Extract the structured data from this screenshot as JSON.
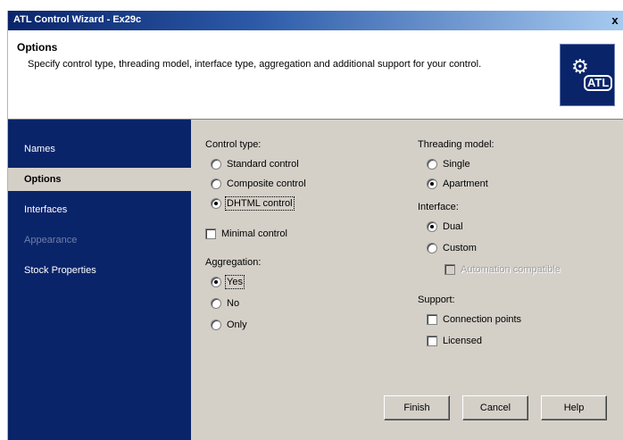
{
  "window": {
    "title": "ATL Control Wizard - Ex29c",
    "close_glyph": "x"
  },
  "header": {
    "title": "Options",
    "description": "Specify control type, threading model, interface type, aggregation and additional support for your control.",
    "logo_text": "ATL",
    "logo_icon": "gear-icon"
  },
  "sidebar": {
    "items": [
      {
        "label": "Names",
        "state": "normal"
      },
      {
        "label": "Options",
        "state": "selected"
      },
      {
        "label": "Interfaces",
        "state": "normal"
      },
      {
        "label": "Appearance",
        "state": "disabled"
      },
      {
        "label": "Stock Properties",
        "state": "normal"
      }
    ]
  },
  "control_type": {
    "label": "Control type:",
    "options": [
      {
        "label": "Standard control",
        "checked": false
      },
      {
        "label": "Composite control",
        "checked": false
      },
      {
        "label": "DHTML control",
        "checked": true
      }
    ]
  },
  "minimal_control": {
    "label": "Minimal control",
    "checked": false
  },
  "aggregation": {
    "label": "Aggregation:",
    "options": [
      {
        "label": "Yes",
        "checked": true
      },
      {
        "label": "No",
        "checked": false
      },
      {
        "label": "Only",
        "checked": false
      }
    ]
  },
  "threading": {
    "label": "Threading model:",
    "options": [
      {
        "label": "Single",
        "checked": false
      },
      {
        "label": "Apartment",
        "checked": true
      }
    ]
  },
  "interface": {
    "label": "Interface:",
    "options": [
      {
        "label": "Dual",
        "checked": true
      },
      {
        "label": "Custom",
        "checked": false
      }
    ],
    "automation_compatible": {
      "label": "Automation compatible",
      "checked": false,
      "enabled": false
    }
  },
  "support": {
    "label": "Support:",
    "options": [
      {
        "label": "Connection points",
        "checked": false
      },
      {
        "label": "Licensed",
        "checked": false
      }
    ]
  },
  "buttons": {
    "finish": "Finish",
    "cancel": "Cancel",
    "help": "Help"
  },
  "colors": {
    "sidebar_bg": "#0a246a",
    "dialog_bg": "#d4d0c8",
    "disabled_text": "#6f7fa8"
  }
}
